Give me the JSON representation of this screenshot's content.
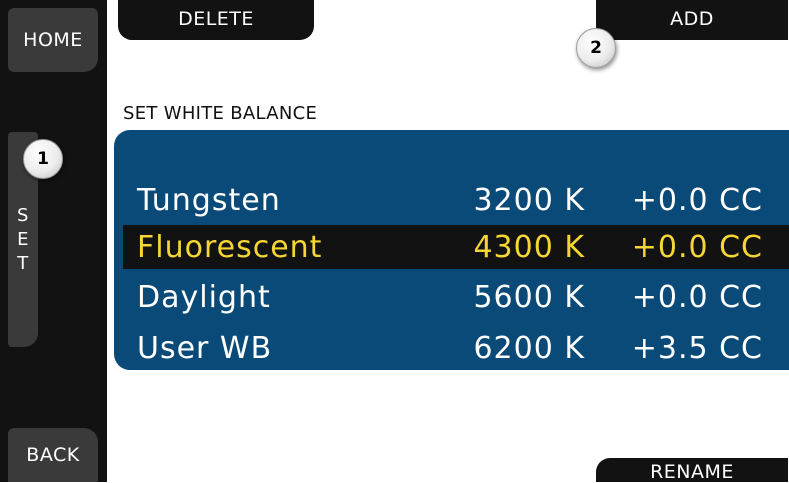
{
  "softkeys": {
    "home": "HOME",
    "back": "BACK",
    "set_letters": [
      "S",
      "E",
      "T"
    ]
  },
  "top_buttons": {
    "delete": "DELETE",
    "add": "ADD"
  },
  "bottom_buttons": {
    "rename": "RENAME"
  },
  "screen_title": "SET WHITE BALANCE",
  "white_balance_list": [
    {
      "name": "Tungsten",
      "temp": "3200 K",
      "cc": "+0.0 CC"
    },
    {
      "name": "Fluorescent",
      "temp": "4300 K",
      "cc": "+0.0 CC"
    },
    {
      "name": "Daylight",
      "temp": "5600 K",
      "cc": "+0.0 CC"
    },
    {
      "name": "User WB",
      "temp": "6200 K",
      "cc": "+3.5 CC"
    }
  ],
  "selected_index": 1,
  "callouts": [
    "1",
    "2"
  ],
  "colors": {
    "panel": "#0a4a78",
    "selected_text": "#f5d633",
    "softkey": "#3a3a3a",
    "bar": "#121212"
  }
}
